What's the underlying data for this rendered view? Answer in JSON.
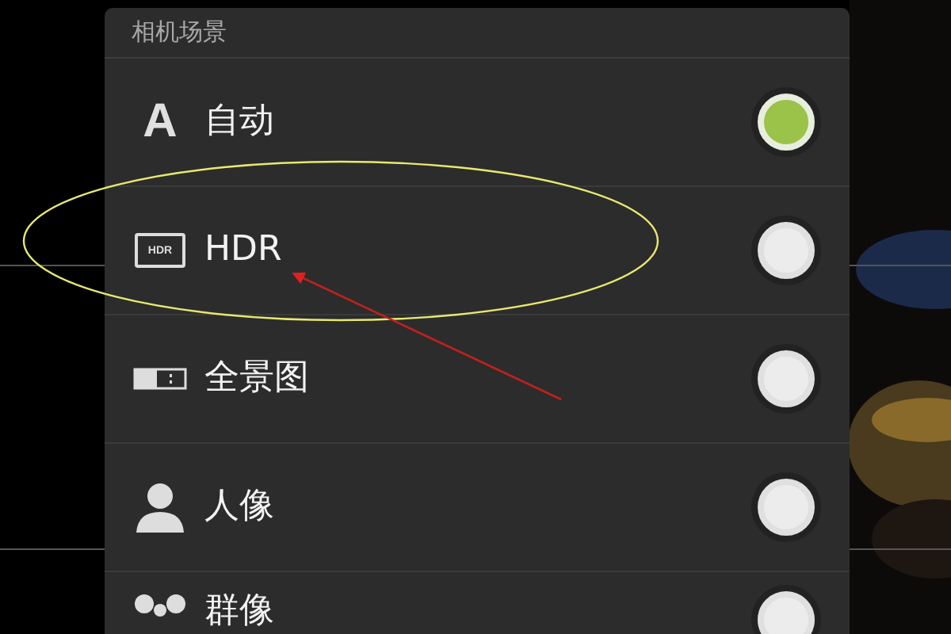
{
  "dialog": {
    "title": "相机场景"
  },
  "options": [
    {
      "kind": "letter",
      "icon_text": "A",
      "label": "自动",
      "selected": true
    },
    {
      "kind": "hdr",
      "icon_text": "HDR",
      "label": "HDR",
      "selected": false
    },
    {
      "kind": "panorama",
      "label": "全景图",
      "selected": false
    },
    {
      "kind": "portrait",
      "label": "人像",
      "selected": false
    },
    {
      "kind": "group",
      "label": "群像",
      "selected": false
    }
  ]
}
